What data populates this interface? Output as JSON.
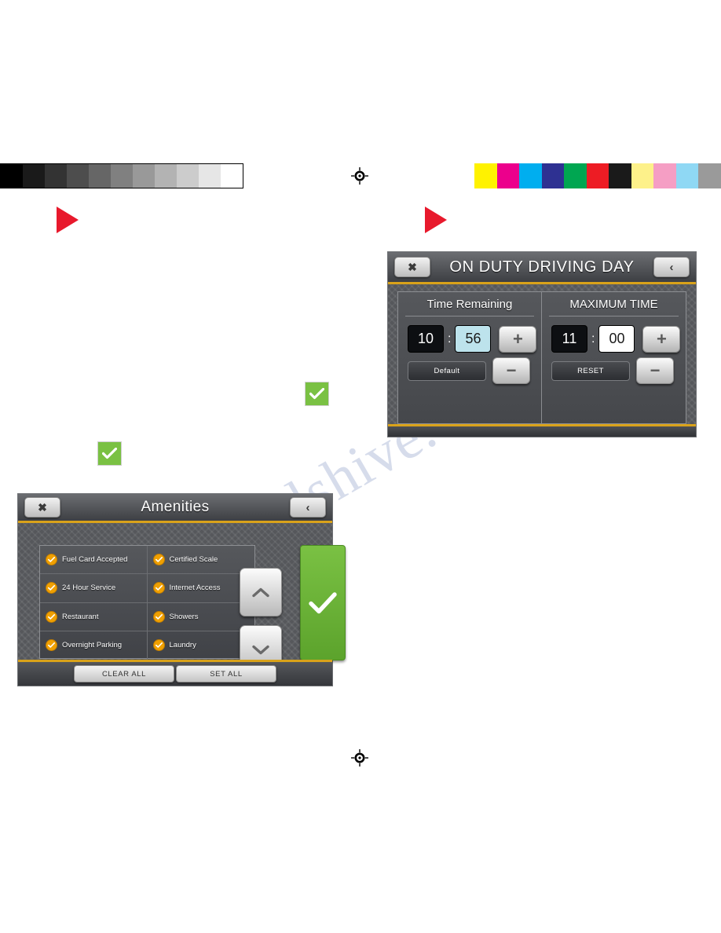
{
  "page": {
    "watermark_text": "manualshive.com"
  },
  "calibration": {
    "gray_strip": {
      "name": "grayscale-step-wedge",
      "swatches": [
        "#000000",
        "#1a1a1a",
        "#333333",
        "#4d4d4d",
        "#666666",
        "#808080",
        "#999999",
        "#b3b3b3",
        "#cccccc",
        "#e6e6e6",
        "#ffffff"
      ]
    },
    "color_strip": {
      "name": "color-control-bar",
      "swatches": [
        "#fff200",
        "#ec008c",
        "#00aeef",
        "#2e3192",
        "#00a651",
        "#ed1c24",
        "#1a1a1a",
        "#fdf18a",
        "#f59ec4",
        "#8fd8f4",
        "#9a9a9a"
      ]
    },
    "registration_marks": 2,
    "play_triangles": 2,
    "check_badges": 2
  },
  "amenities_screen": {
    "title": "Amenities",
    "close_label": "✖",
    "back_label": "‹",
    "rows": [
      [
        {
          "label": "Fuel Card Accepted",
          "checked": true
        },
        {
          "label": "Certified Scale",
          "checked": true
        }
      ],
      [
        {
          "label": "24 Hour Service",
          "checked": true
        },
        {
          "label": "Internet Access",
          "checked": true
        }
      ],
      [
        {
          "label": "Restaurant",
          "checked": true
        },
        {
          "label": "Showers",
          "checked": true
        }
      ],
      [
        {
          "label": "Overnight Parking",
          "checked": true
        },
        {
          "label": "Laundry",
          "checked": true
        }
      ]
    ],
    "scroll_up_icon": "chevron-up-icon",
    "scroll_down_icon": "chevron-down-icon",
    "confirm_icon": "check-icon",
    "footer": {
      "clear_all": "CLEAR ALL",
      "set_all": "SET ALL"
    }
  },
  "onduty_screen": {
    "title": "ON DUTY DRIVING DAY",
    "close_label": "✖",
    "back_label": "‹",
    "columns": [
      {
        "heading": "Time Remaining",
        "hours": "10",
        "separator": ":",
        "minutes": "56",
        "minutes_selected": true,
        "plus_label": "+",
        "minus_label": "−",
        "action_label": "Default"
      },
      {
        "heading": "MAXIMUM TIME",
        "hours": "11",
        "separator": ":",
        "minutes": "00",
        "minutes_selected": false,
        "plus_label": "+",
        "minus_label": "−",
        "action_label": "RESET"
      }
    ]
  }
}
